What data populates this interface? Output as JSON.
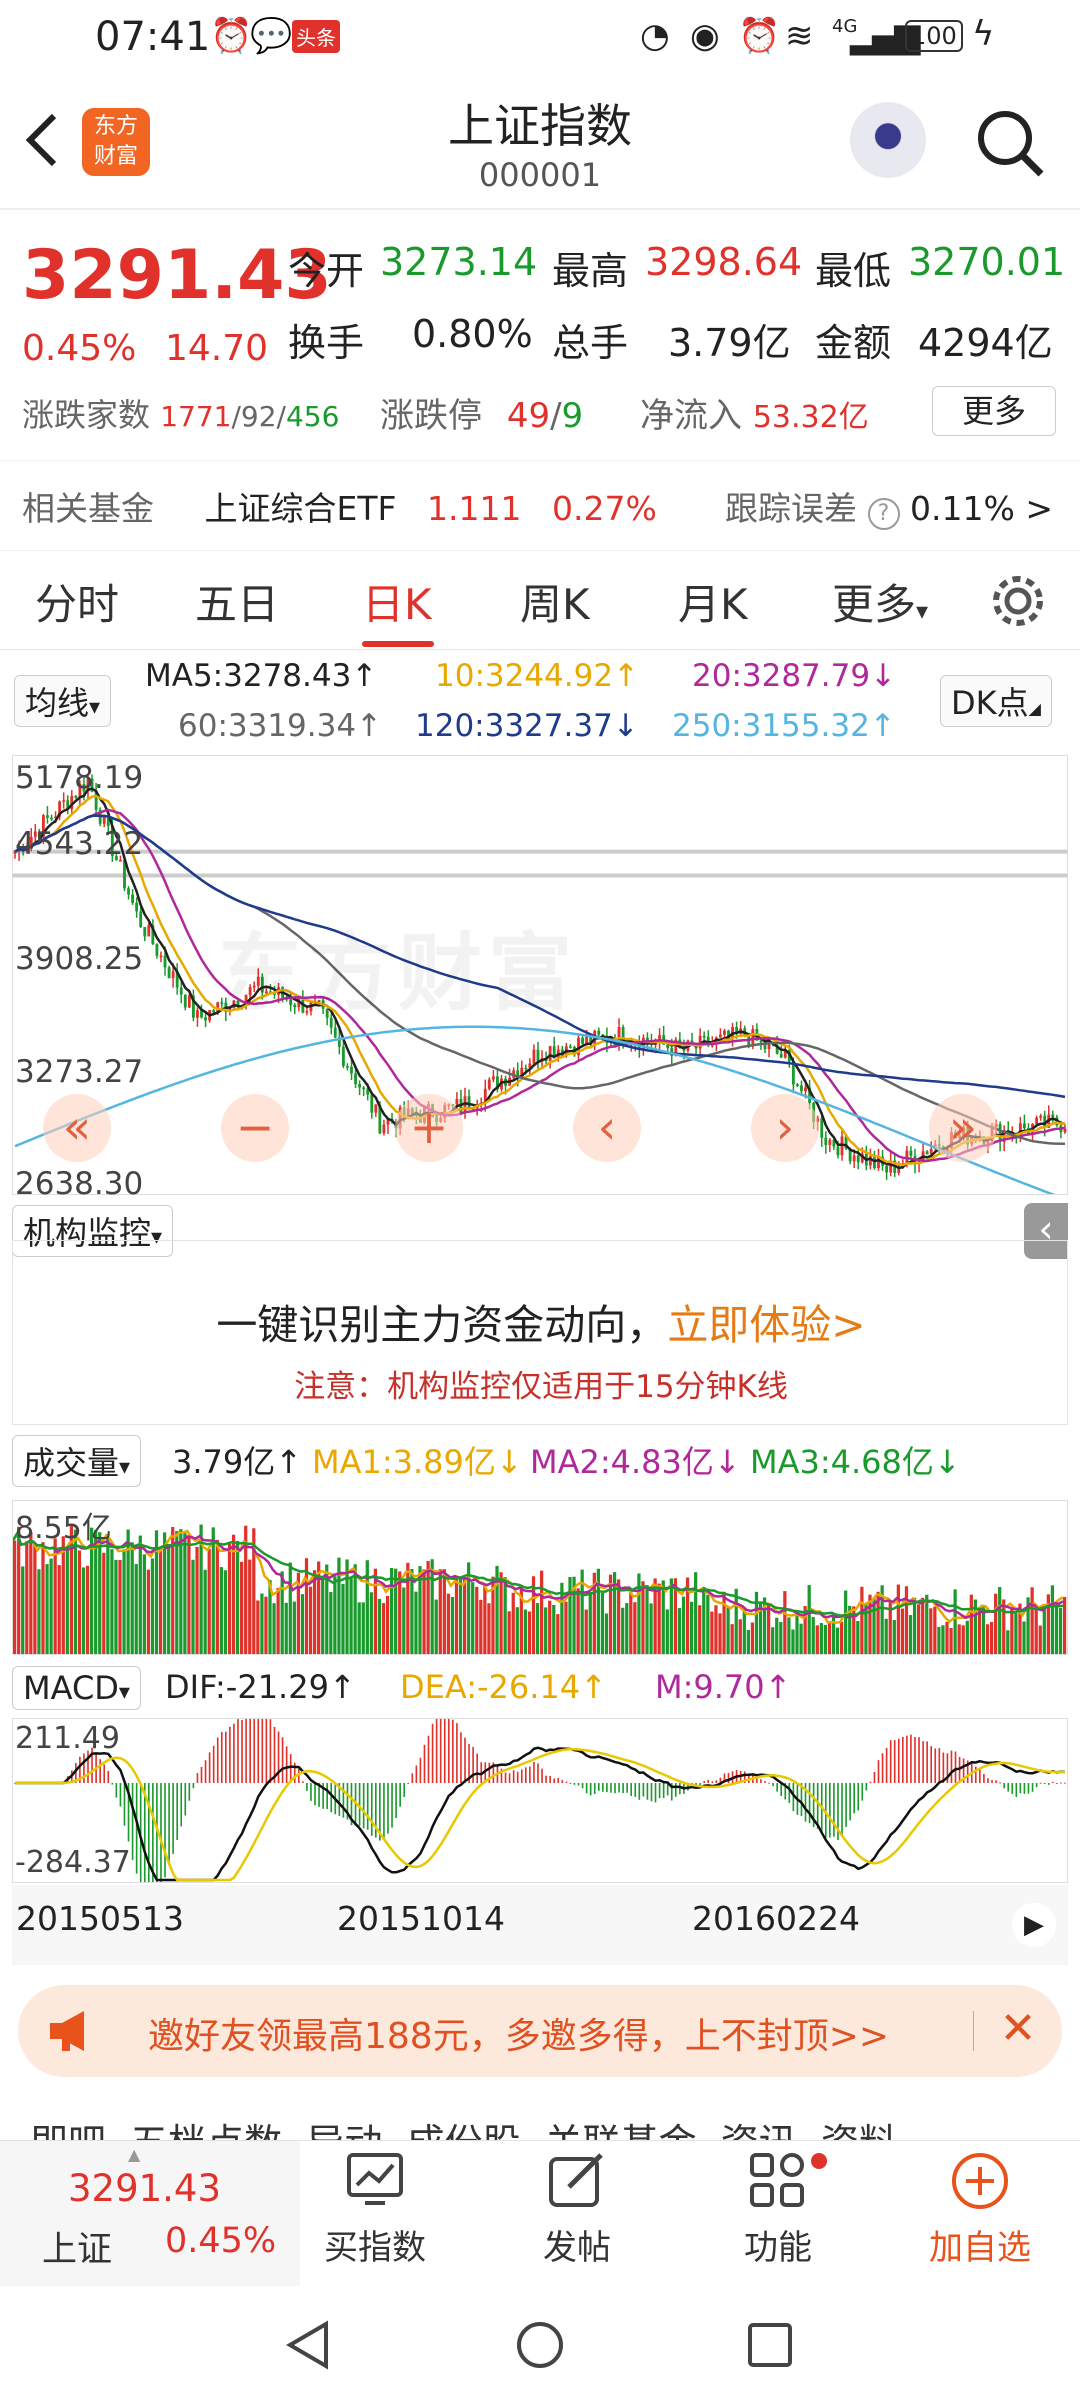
{
  "status": {
    "time": "07:41",
    "toutiao": "头条",
    "network": "4G",
    "battery": "100"
  },
  "header": {
    "title": "上证指数",
    "code": "000001",
    "logo_line1": "东方",
    "logo_line2": "财富"
  },
  "quote": {
    "price": "3291.43",
    "pct": "0.45%",
    "change": "14.70",
    "open_label": "今开",
    "open": "3273.14",
    "high_label": "最高",
    "high": "3298.64",
    "low_label": "最低",
    "low": "3270.01",
    "turnover_label": "换手",
    "turnover": "0.80%",
    "volume_label": "总手",
    "volume": "3.79亿",
    "amount_label": "金额",
    "amount": "4294亿",
    "breadth_label": "涨跌家数",
    "up": "1771",
    "sep1": "/",
    "flat": "92",
    "sep2": "/",
    "down": "456",
    "limit_label": "涨跌停",
    "limit_up": "49",
    "limit_sep": "/",
    "limit_down": "9",
    "inflow_label": "净流入",
    "inflow": "53.32亿",
    "more": "更多",
    "fund_label": "相关基金",
    "fund_name": "上证综合ETF",
    "fund_price": "1.111",
    "fund_pct": "0.27%",
    "track_label": "跟踪误差",
    "track_value": "0.11%",
    "track_arrow": ">"
  },
  "tabs": [
    "分时",
    "五日",
    "日K",
    "周K",
    "月K",
    "更多"
  ],
  "ma": {
    "selector": "均线",
    "ma5": "MA5:3278.43↑",
    "ma10": "10:3244.92↑",
    "ma20": "20:3287.79↓",
    "ma60": "60:3319.34↑",
    "ma120": "120:3327.37↓",
    "ma250": "250:3155.32↑",
    "dk": "DK点"
  },
  "kline_axis": [
    "5178.19",
    "4543.22",
    "3908.25",
    "3273.27",
    "2638.30"
  ],
  "watermark": "东方财富",
  "inst": {
    "selector": "机构监控",
    "headline": "一键识别主力资金动向，",
    "cta": "立即体验>",
    "note": "注意：机构监控仅适用于15分钟K线"
  },
  "vol": {
    "selector": "成交量",
    "value": "3.79亿↑",
    "ma1": "MA1:3.89亿↓",
    "ma2": "MA2:4.83亿↓",
    "ma3": "MA3:4.68亿↓",
    "axis_top": "8.55亿"
  },
  "macd": {
    "selector": "MACD",
    "dif": "DIF:-21.29↑",
    "dea": "DEA:-26.14↑",
    "m": "M:9.70↑",
    "axis_top": "211.49",
    "axis_bottom": "-284.37"
  },
  "dates": [
    "20150513",
    "20151014",
    "20160224"
  ],
  "invite": {
    "text": "邀好友领最高188元，多邀多得，上不封顶>>"
  },
  "bottom": {
    "index_price": "3291.43",
    "index_name": "上证",
    "index_pct": "0.45%",
    "buy": "买指数",
    "post": "发帖",
    "func": "功能",
    "add": "加自选"
  },
  "partial_tabs": "即吧  五档点数  异动  成份股  关联基金  资讯  资料",
  "colors": {
    "up": "#e0312b",
    "down": "#1a9a2c",
    "ma5": "#222222",
    "ma10": "#e8a800",
    "ma20": "#b0289a",
    "ma60": "#666666",
    "ma120": "#1f3c8c",
    "ma250": "#54b6e0"
  }
}
